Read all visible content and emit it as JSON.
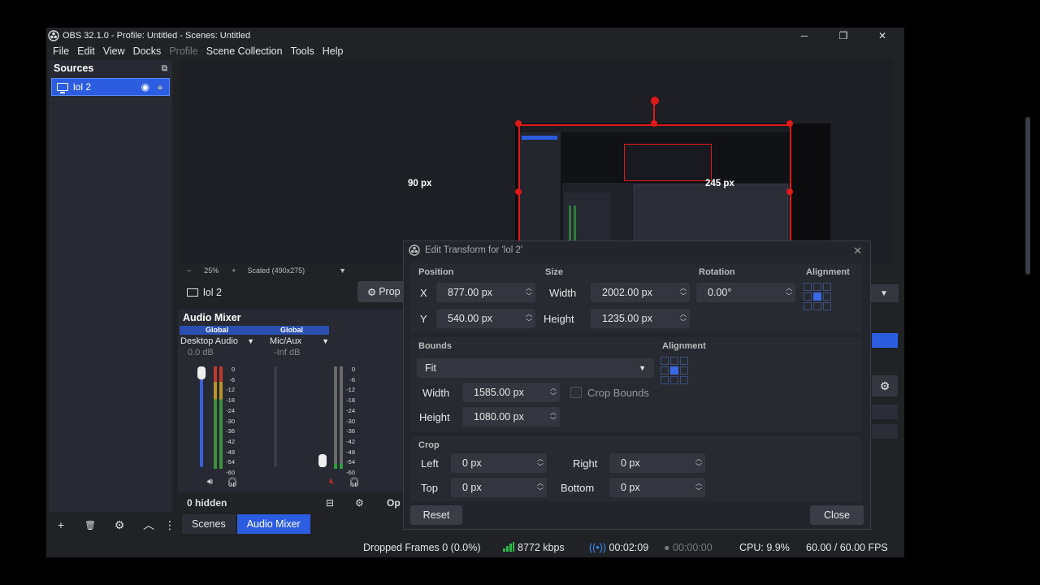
{
  "window": {
    "title": "OBS 32.1.0 - Profile: Untitled - Scenes: Untitled",
    "minimize": "─",
    "restore": "❐",
    "close": "✕"
  },
  "menu": [
    "File",
    "Edit",
    "View",
    "Docks",
    "Profile",
    "Scene Collection",
    "Tools",
    "Help"
  ],
  "sources": {
    "title": "Sources",
    "items": [
      {
        "name": "lol 2"
      }
    ]
  },
  "bottom_toolbar": {
    "add": "+",
    "remove": "🗑",
    "settings": "⚙",
    "up": "︿",
    "more": "⋮"
  },
  "preview": {
    "left_label": "90 px",
    "right_label": "245 px",
    "zoom_out": "−",
    "zoom": "25%",
    "zoom_in": "+",
    "scaled": "Scaled (490x275)"
  },
  "context_bar": {
    "source_name": "lol 2",
    "properties": "Prop"
  },
  "mixer": {
    "title": "Audio Mixer",
    "channels": [
      {
        "scope": "Global",
        "name": "Desktop Audio",
        "db": "0.0 dB"
      },
      {
        "scope": "Global",
        "name": "Mic/Aux",
        "db": "-Inf dB"
      }
    ],
    "scale": [
      "0",
      "-6",
      "-12",
      "-18",
      "-24",
      "-30",
      "-36",
      "-42",
      "-48",
      "-54",
      "-60"
    ],
    "hidden": "0 hidden",
    "options": "Op"
  },
  "tabs": {
    "scenes": "Scenes",
    "audio_mixer": "Audio Mixer"
  },
  "status": {
    "dropped": "Dropped Frames 0 (0.0%)",
    "bitrate": "8772 kbps",
    "stream_time": "00:02:09",
    "record_time": "00:00:00",
    "cpu": "CPU: 9.9%",
    "fps": "60.00 / 60.00 FPS"
  },
  "dialog": {
    "title": "Edit Transform for 'lol 2'",
    "position_label": "Position",
    "size_label": "Size",
    "rotation_label": "Rotation",
    "alignment_label": "Alignment",
    "x_label": "X",
    "y_label": "Y",
    "x": "877.00 px",
    "y": "540.00 px",
    "width_label": "Width",
    "height_label": "Height",
    "width": "2002.00 px",
    "height": "1235.00 px",
    "rotation": "0.00°",
    "bounds_label": "Bounds",
    "bounds_alignment_label": "Alignment",
    "bounds_type": "Fit",
    "bounds_width": "1585.00 px",
    "bounds_height": "1080.00 px",
    "crop_bounds": "Crop Bounds",
    "crop_label": "Crop",
    "left_label": "Left",
    "right_label": "Right",
    "top_label": "Top",
    "bottom_label": "Bottom",
    "crop_left": "0 px",
    "crop_right": "0 px",
    "crop_top": "0 px",
    "crop_bottom": "0 px",
    "reset": "Reset",
    "close": "Close"
  }
}
